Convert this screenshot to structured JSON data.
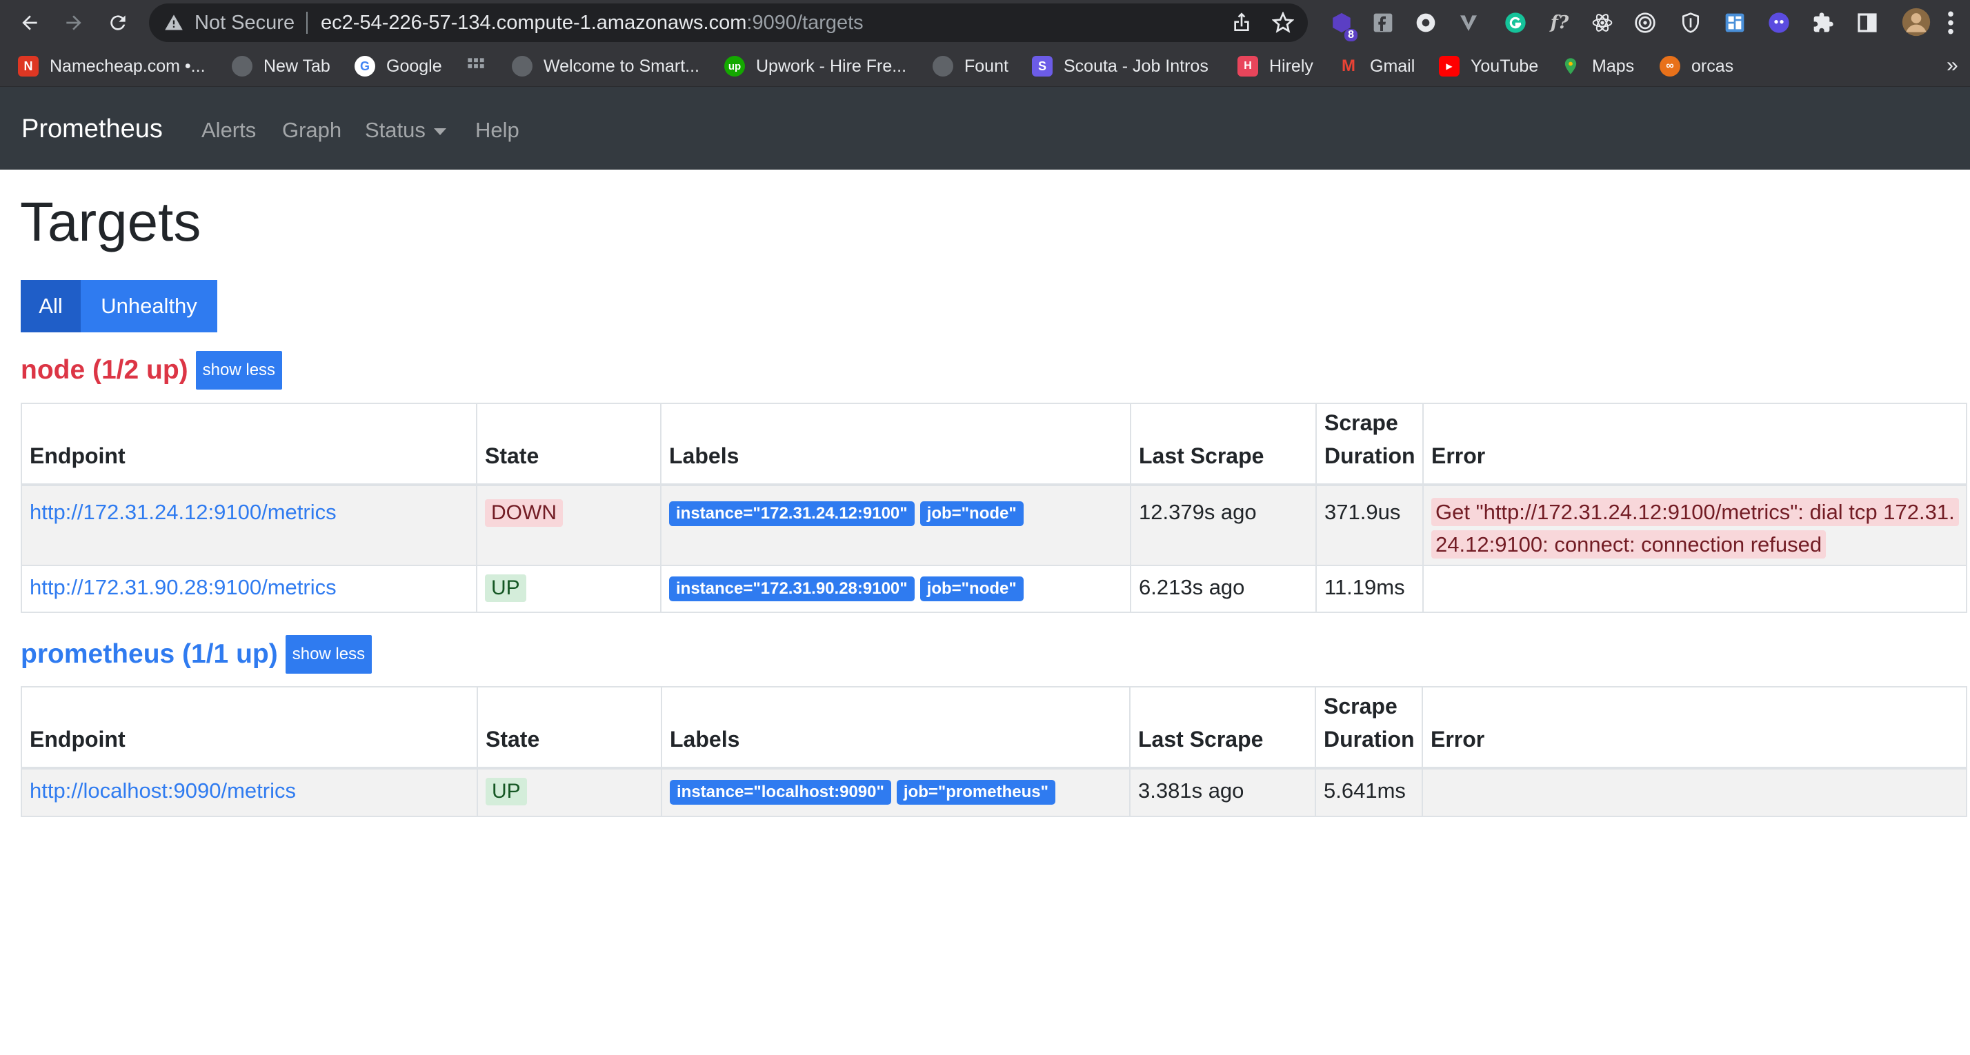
{
  "browser": {
    "security_label": "Not Secure",
    "url_host": "ec2-54-226-57-134.compute-1.amazonaws.com",
    "url_rest": ":9090/targets",
    "extension_badge": "8",
    "bookmarks": [
      {
        "label": "Namecheap.com •...",
        "icon": "namecheap-icon",
        "color": "#de3723"
      },
      {
        "label": "New Tab",
        "icon": "globe-icon",
        "color": "#5f6368"
      },
      {
        "label": "Google",
        "icon": "google-icon",
        "color": "#ffffff"
      },
      {
        "label": "Welcome to Smart...",
        "icon": "globe-icon",
        "color": "#5f6368"
      },
      {
        "label": "Upwork - Hire Fre...",
        "icon": "upwork-icon",
        "color": "#14a800"
      },
      {
        "label": "Fount",
        "icon": "globe-icon",
        "color": "#5f6368"
      },
      {
        "label": "Scouta - Job Intros",
        "icon": "scouta-icon",
        "color": "#6c5ce7"
      },
      {
        "label": "Hirely",
        "icon": "hirely-icon",
        "color": "#e8455b"
      },
      {
        "label": "Gmail",
        "icon": "gmail-icon",
        "color": "#ea4335"
      },
      {
        "label": "YouTube",
        "icon": "youtube-icon",
        "color": "#ff0000"
      },
      {
        "label": "Maps",
        "icon": "maps-icon",
        "color": "#34a853"
      },
      {
        "label": "orcas",
        "icon": "orcas-icon",
        "color": "#e8711a"
      }
    ],
    "bookmarks_more": "»"
  },
  "navbar": {
    "brand": "Prometheus",
    "links": [
      "Alerts",
      "Graph",
      "Status",
      "Help"
    ]
  },
  "page": {
    "title": "Targets",
    "filters": {
      "all": "All",
      "unhealthy": "Unhealthy"
    }
  },
  "table_headers": {
    "endpoint": "Endpoint",
    "state": "State",
    "labels": "Labels",
    "last_scrape": "Last Scrape",
    "scrape_duration": "Scrape Duration",
    "error": "Error"
  },
  "jobs": [
    {
      "title": "node (1/2 up)",
      "toggle": "show less",
      "status": "down",
      "rows": [
        {
          "endpoint": "http://172.31.24.12:9100/metrics",
          "state": "DOWN",
          "labels": [
            "instance=\"172.31.24.12:9100\"",
            "job=\"node\""
          ],
          "last_scrape": "12.379s ago",
          "scrape_duration": "371.9us",
          "error": "Get \"http://172.31.24.12:9100/metrics\": dial tcp 172.31.24.12:9100: connect: connection refused"
        },
        {
          "endpoint": "http://172.31.90.28:9100/metrics",
          "state": "UP",
          "labels": [
            "instance=\"172.31.90.28:9100\"",
            "job=\"node\""
          ],
          "last_scrape": "6.213s ago",
          "scrape_duration": "11.19ms",
          "error": ""
        }
      ]
    },
    {
      "title": "prometheus (1/1 up)",
      "toggle": "show less",
      "status": "up",
      "rows": [
        {
          "endpoint": "http://localhost:9090/metrics",
          "state": "UP",
          "labels": [
            "instance=\"localhost:9090\"",
            "job=\"prometheus\""
          ],
          "last_scrape": "3.381s ago",
          "scrape_duration": "5.641ms",
          "error": ""
        }
      ]
    }
  ],
  "colors": {
    "navbar_bg": "#343a40",
    "link_blue": "#2f7bf0",
    "danger": "#dc3545",
    "badge_down_bg": "#f8d7da",
    "badge_up_bg": "#d4edda"
  }
}
